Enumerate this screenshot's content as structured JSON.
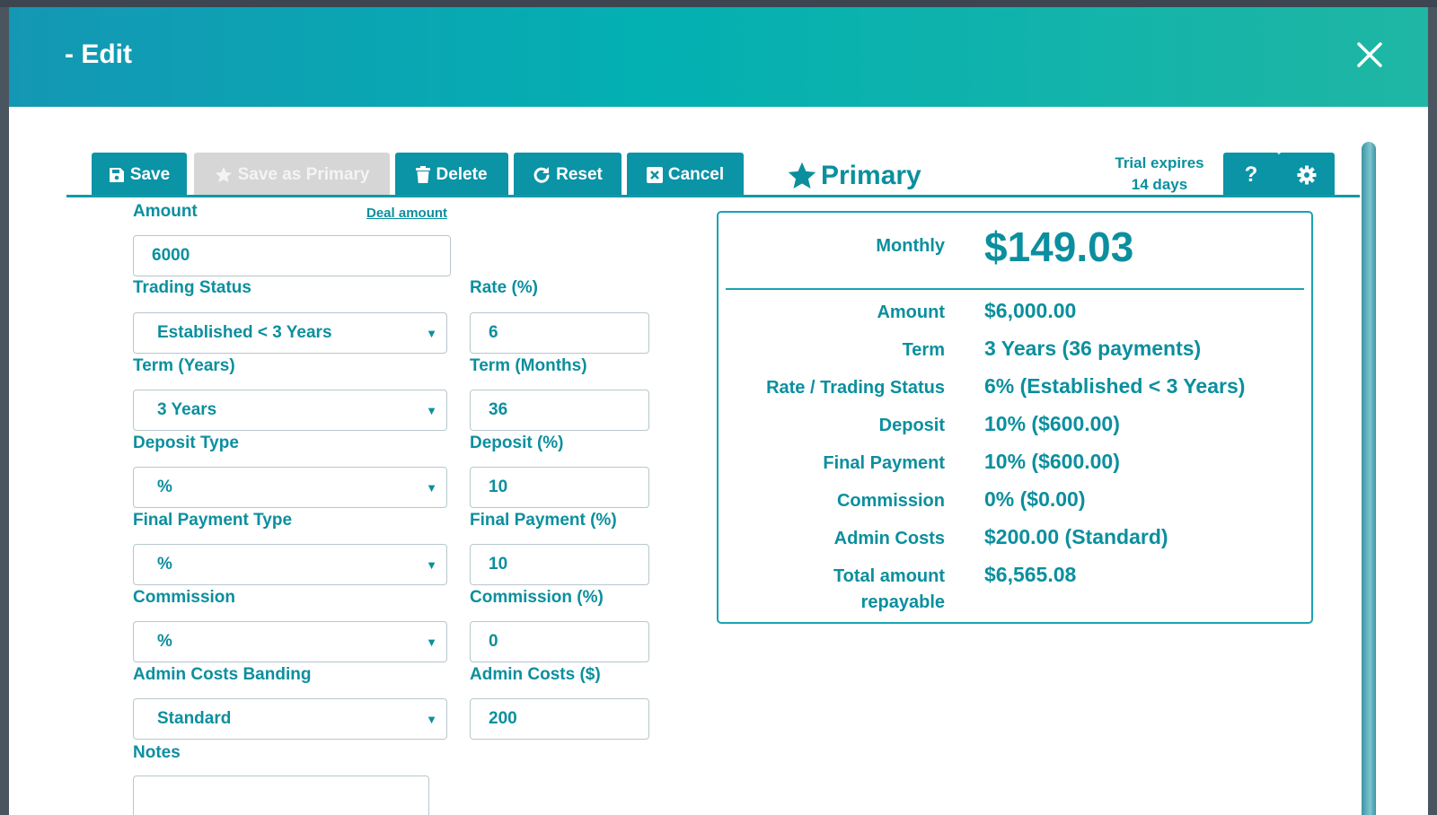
{
  "header": {
    "title": "- Edit"
  },
  "toolbar": {
    "save": "Save",
    "save_as_primary": "Save as Primary",
    "delete": "Delete",
    "reset": "Reset",
    "cancel": "Cancel",
    "primary": "Primary",
    "trial_line1": "Trial expires",
    "trial_line2": "14 days",
    "help": "?"
  },
  "form": {
    "amount_label": "Amount",
    "deal_amount_link": "Deal amount",
    "amount_value": "6000",
    "trading_status_label": "Trading Status",
    "trading_status_value": "Established < 3 Years",
    "rate_label": "Rate (%)",
    "rate_value": "6",
    "term_years_label": "Term (Years)",
    "term_years_value": "3 Years",
    "term_months_label": "Term (Months)",
    "term_months_value": "36",
    "deposit_type_label": "Deposit Type",
    "deposit_type_value": "%",
    "deposit_pct_label": "Deposit (%)",
    "deposit_pct_value": "10",
    "final_payment_type_label": "Final Payment Type",
    "final_payment_type_value": "%",
    "final_payment_pct_label": "Final Payment (%)",
    "final_payment_pct_value": "10",
    "commission_label": "Commission",
    "commission_value": "%",
    "commission_pct_label": "Commission (%)",
    "commission_pct_value": "0",
    "admin_banding_label": "Admin Costs Banding",
    "admin_banding_value": "Standard",
    "admin_costs_label": "Admin Costs ($)",
    "admin_costs_value": "200",
    "notes_label": "Notes",
    "notes_value": ""
  },
  "summary": {
    "monthly_label": "Monthly",
    "monthly_value": "$149.03",
    "rows": [
      {
        "label": "Amount",
        "value": "$6,000.00"
      },
      {
        "label": "Term",
        "value": "3 Years (36 payments)"
      },
      {
        "label": "Rate / Trading Status",
        "value": "6% (Established < 3 Years)"
      },
      {
        "label": "Deposit",
        "value": "10% ($600.00)"
      },
      {
        "label": "Final Payment",
        "value": "10% ($600.00)"
      },
      {
        "label": "Commission",
        "value": "0% ($0.00)"
      },
      {
        "label": "Admin Costs",
        "value": "$200.00 (Standard)"
      }
    ],
    "total_label_line1": "Total amount",
    "total_label_line2": "repayable",
    "total_value": "$6,565.08"
  },
  "colors": {
    "accent": "#0b8f9e",
    "button": "#0b93a6",
    "disabled": "#d6d6d6"
  },
  "icons": [
    "close-icon",
    "floppy-disk-icon",
    "star-icon",
    "trash-icon",
    "refresh-icon",
    "x-square-icon",
    "gear-icon",
    "chevron-down-icon"
  ]
}
